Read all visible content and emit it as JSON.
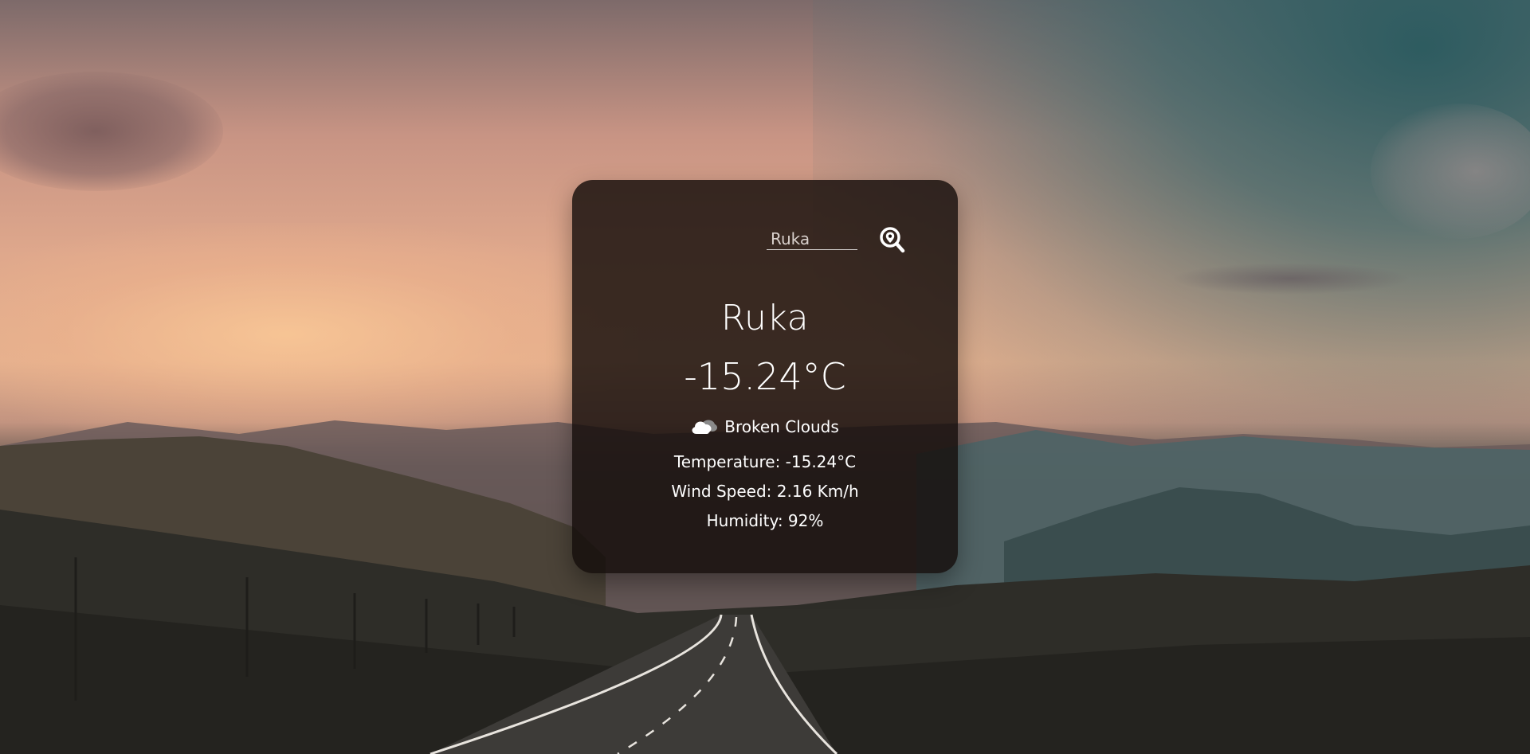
{
  "search": {
    "value": "Ruka",
    "button_icon": "search-location-icon"
  },
  "weather": {
    "city": "Ruka",
    "temperature": "-15.24°C",
    "condition_icon": "broken-clouds-icon",
    "condition": "Broken Clouds",
    "temperature_detail": "Temperature: -15.24°C",
    "wind_speed": "Wind Speed: 2.16 Km/h",
    "humidity": "Humidity: 92%"
  }
}
